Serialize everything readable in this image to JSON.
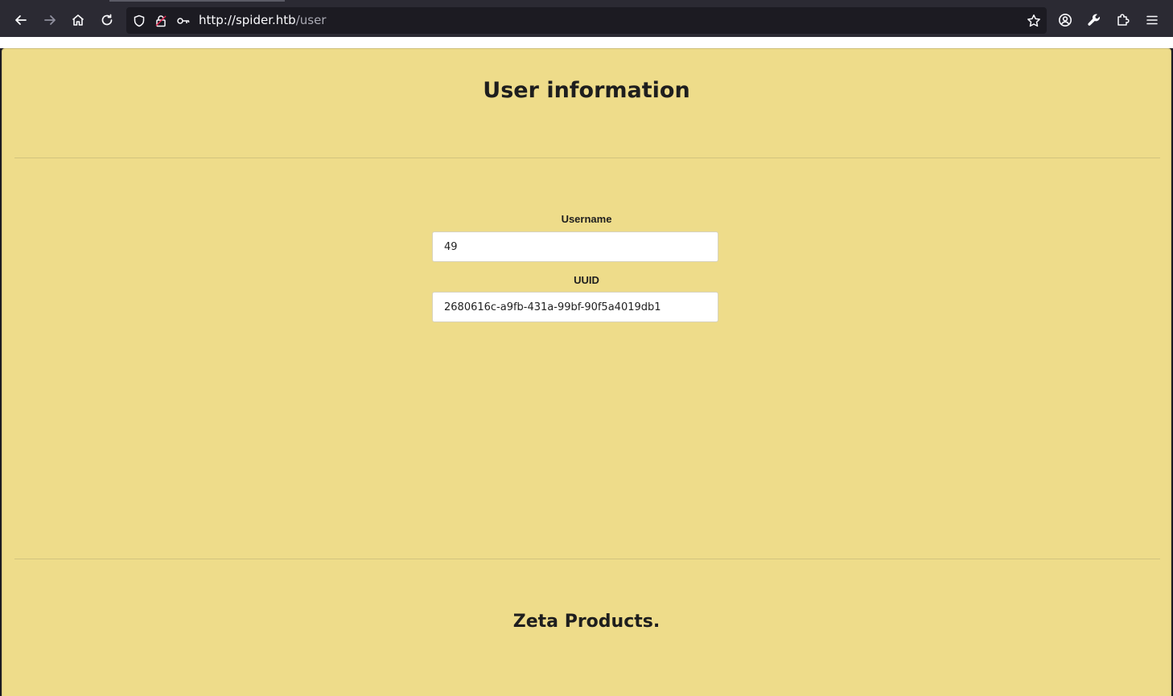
{
  "browser": {
    "url_host": "http://spider.htb",
    "url_path": "/user"
  },
  "page": {
    "title": "User information",
    "fields": [
      {
        "label": "Username",
        "value": "49"
      },
      {
        "label": "UUID",
        "value": "2680616c-a9fb-431a-99bf-90f5a4019db1"
      }
    ],
    "footer_title": "Zeta Products."
  },
  "colors": {
    "page_background": "#eedc8a",
    "toolbar_background": "#2b2a33"
  }
}
